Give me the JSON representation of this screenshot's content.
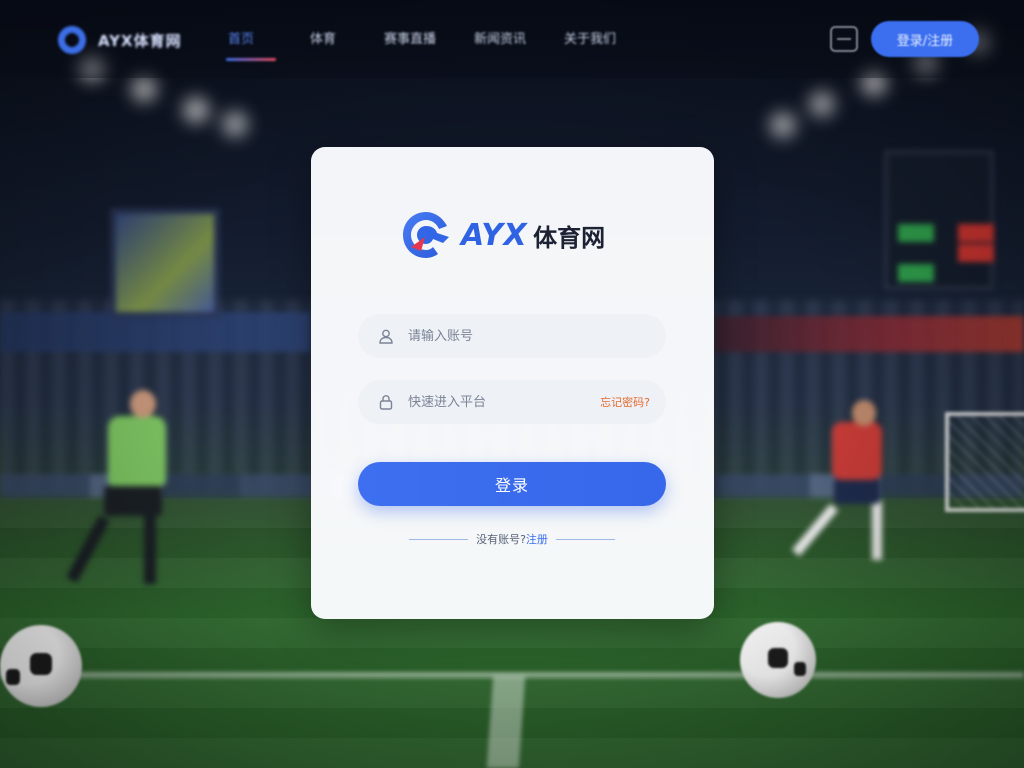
{
  "nav": {
    "logo_text": "AYX体育网",
    "links": [
      "首页",
      "体育",
      "赛事直播",
      "新闻资讯",
      "关于我们"
    ],
    "cta_label": "登录/注册",
    "active_index": 0
  },
  "login": {
    "brand_latin": "AYX",
    "brand_cn": "体育网",
    "username_placeholder": "请输入账号",
    "password_placeholder": "快速进入平台",
    "forgot_label": "忘记密码?",
    "submit_label": "登录",
    "alt_prefix": "没有账号?",
    "alt_link": "注册"
  },
  "colors": {
    "accent": "#3b6ff0",
    "forgot": "#e46a2e",
    "card_bg": "#fcfdff"
  },
  "icons": {
    "user": "user-icon",
    "lock": "lock-icon",
    "menu": "menu-icon"
  }
}
